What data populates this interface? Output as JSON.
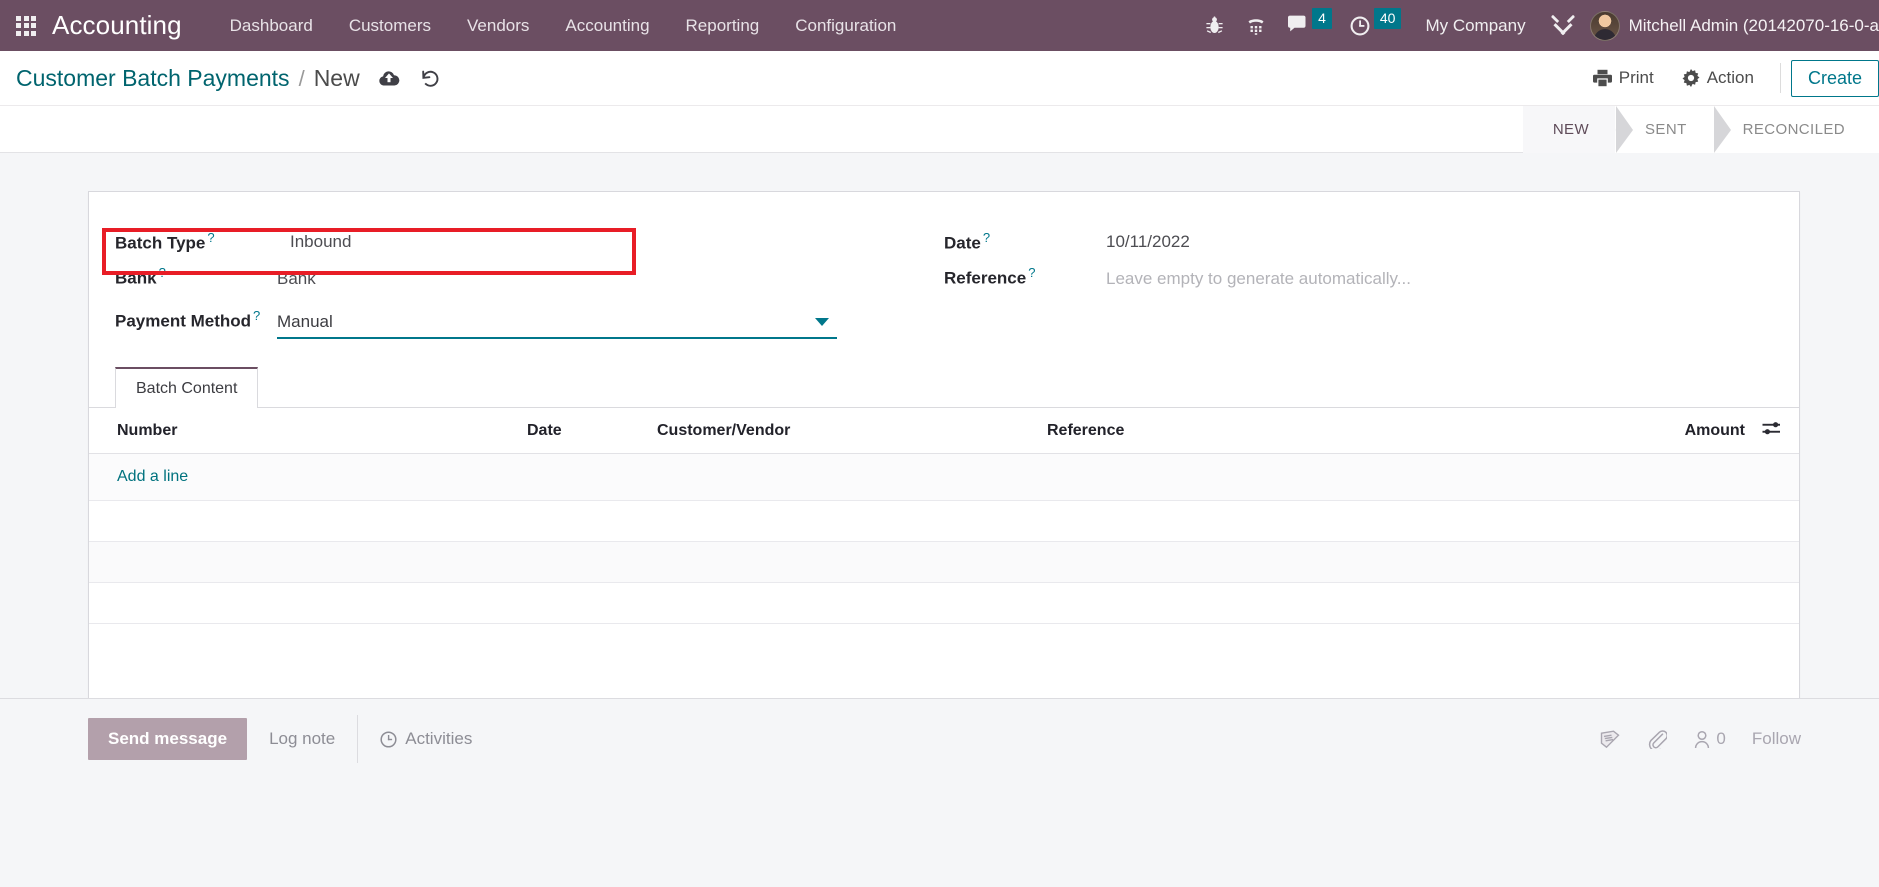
{
  "navbar": {
    "apps_icon": "apps-grid-icon",
    "brand": "Accounting",
    "menus": [
      {
        "label": "Dashboard"
      },
      {
        "label": "Customers"
      },
      {
        "label": "Vendors"
      },
      {
        "label": "Accounting"
      },
      {
        "label": "Reporting"
      },
      {
        "label": "Configuration"
      }
    ],
    "icons": [
      {
        "name": "bug-icon",
        "title": "Debug"
      },
      {
        "name": "dialpad-icon",
        "title": "Phone"
      }
    ],
    "messages": {
      "icon": "chat-bubble-icon",
      "count": "4"
    },
    "activities": {
      "icon": "clock-icon",
      "count": "40"
    },
    "company": "My Company",
    "settings_icon": "tools-icon",
    "user": {
      "avatar": "user-avatar",
      "name": "Mitchell Admin (20142070-16-0-a"
    }
  },
  "control_panel": {
    "breadcrumb": {
      "parent": "Customer Batch Payments",
      "separator": "/",
      "current": "New"
    },
    "save_icon": "cloud-upload-icon",
    "discard_icon": "undo-icon",
    "print": {
      "label": "Print",
      "icon": "printer-icon"
    },
    "action": {
      "label": "Action",
      "icon": "gear-icon"
    },
    "create": {
      "label": "Create"
    },
    "statusbar": [
      {
        "label": "NEW",
        "active": true
      },
      {
        "label": "SENT",
        "active": false
      },
      {
        "label": "RECONCILED",
        "active": false
      }
    ]
  },
  "form": {
    "left": [
      {
        "label": "Batch Type",
        "help": "?",
        "value": "Inbound",
        "widget": "readonly",
        "highlighted": true
      },
      {
        "label": "Bank",
        "help": "?",
        "value": "Bank",
        "widget": "readonly"
      },
      {
        "label": "Payment Method",
        "help": "?",
        "value": "Manual",
        "widget": "select"
      }
    ],
    "right": [
      {
        "label": "Date",
        "help": "?",
        "value": "10/11/2022",
        "widget": "readonly"
      },
      {
        "label": "Reference",
        "help": "?",
        "value": "Leave empty to generate automatically...",
        "widget": "placeholder"
      }
    ]
  },
  "notebook": {
    "tabs": [
      {
        "label": "Batch Content",
        "active": true
      }
    ],
    "table": {
      "columns": [
        "Number",
        "Date",
        "Customer/Vendor",
        "Reference",
        "Amount"
      ],
      "optional_columns_icon": "sliders-icon",
      "rows": [],
      "add_line_label": "Add a line"
    }
  },
  "chatter": {
    "send_message": "Send message",
    "log_note": "Log note",
    "activities": {
      "label": "Activities",
      "icon": "clock-icon"
    },
    "log_icon": "history-book-icon",
    "attachment_icon": "paperclip-icon",
    "followers": {
      "icon": "user-icon",
      "count": "0"
    },
    "follow_label": "Follow"
  },
  "colors": {
    "navbar_bg": "#6b4e62",
    "accent_teal": "#00778b",
    "badge_bg": "#00778b",
    "highlight_red": "#e81d26",
    "page_bg": "#f5f6f8",
    "send_btn_bg": "#b3a0ab"
  }
}
